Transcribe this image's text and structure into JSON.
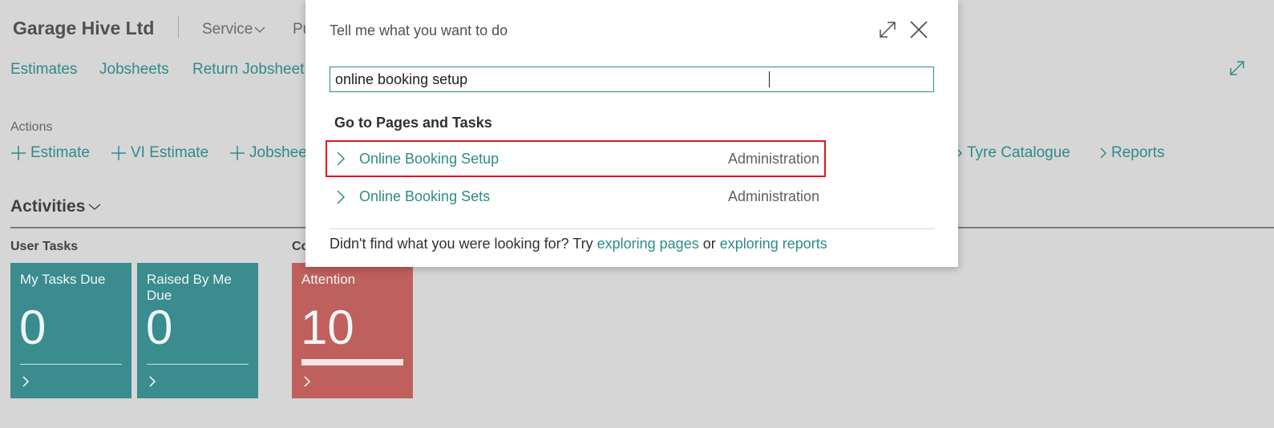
{
  "app": {
    "company": "Garage Hive Ltd",
    "menus": [
      {
        "label": "Service"
      },
      {
        "label": "Pu"
      }
    ],
    "nav_links": [
      "Estimates",
      "Jobsheets",
      "Return Jobsheet"
    ],
    "actions_label": "Actions",
    "actions": [
      {
        "label": "Estimate",
        "icon": "plus-icon"
      },
      {
        "label": "VI Estimate",
        "icon": "plus-icon"
      },
      {
        "label": "Jobshee",
        "icon": "plus-icon"
      },
      {
        "label": "Tyre Catalogue",
        "icon": "chevron-right-icon"
      },
      {
        "label": "Reports",
        "icon": "chevron-right-icon"
      }
    ],
    "activities_title": "Activities",
    "groups": [
      {
        "label": "User Tasks"
      },
      {
        "label": "Co"
      }
    ],
    "tiles": [
      {
        "label": "My Tasks Due",
        "value": "0",
        "color": "#3a8c8f"
      },
      {
        "label": "Raised By Me Due",
        "value": "0",
        "color": "#3a8c8f"
      },
      {
        "label": "Attention",
        "value": "10",
        "color": "#c0605c"
      }
    ],
    "accent_color": "#2f8a88"
  },
  "dialog": {
    "title": "Tell me what you want to do",
    "search_value": "online booking setup",
    "section_title": "Go to Pages and Tasks",
    "results": [
      {
        "name": "Online Booking Setup",
        "category": "Administration",
        "selected": true
      },
      {
        "name": "Online Booking Sets",
        "category": "Administration",
        "selected": false
      }
    ],
    "footer": {
      "prefix": "Didn't find what you were looking for? Try ",
      "link1": "exploring pages",
      "middle": " or ",
      "link2": "exploring reports"
    }
  }
}
